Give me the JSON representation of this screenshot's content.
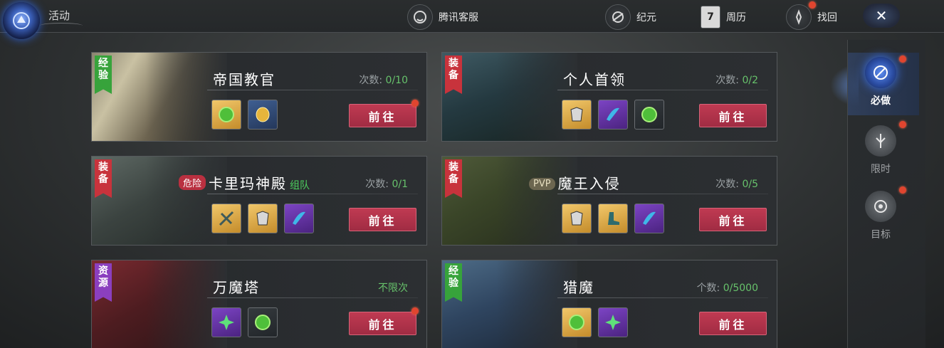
{
  "header": {
    "title": "活动",
    "buttons": [
      {
        "label": "腾讯客服",
        "icon": "customer-service-icon"
      },
      {
        "label": "纪元",
        "icon": "era-icon"
      },
      {
        "label": "周历",
        "icon": "calendar-icon",
        "calendar_day": "7"
      },
      {
        "label": "找回",
        "icon": "retrieve-icon"
      }
    ],
    "close_label": "✕"
  },
  "sidebar": {
    "items": [
      {
        "label": "必做",
        "icon": "must-do-icon",
        "active": true
      },
      {
        "label": "限时",
        "icon": "limited-time-icon",
        "active": false
      },
      {
        "label": "目标",
        "icon": "target-icon",
        "active": false
      }
    ]
  },
  "activities": [
    {
      "tag": "经验",
      "tag_color": "#37a33b",
      "name": "帝国教官",
      "count_label": "次数:",
      "count_value": "0/10",
      "go_label": "前往",
      "items": [
        "exp-orb",
        "gold-coin"
      ]
    },
    {
      "tag": "装备",
      "tag_color": "#c8333c",
      "name": "个人首领",
      "count_label": "次数:",
      "count_value": "0/2",
      "go_label": "前往",
      "items": [
        "armor-chest",
        "crystal-wing",
        "exp-orb"
      ]
    },
    {
      "tag": "装备",
      "tag_color": "#c8333c",
      "badge": "危险",
      "name": "卡里玛神殿",
      "team": "组队",
      "count_label": "次数:",
      "count_value": "0/1",
      "go_label": "前往",
      "items": [
        "crossbow",
        "armor-chest",
        "crystal-wing"
      ]
    },
    {
      "tag": "装备",
      "tag_color": "#c8333c",
      "badge": "PVP",
      "name": "魔王入侵",
      "count_label": "次数:",
      "count_value": "0/5",
      "go_label": "前往",
      "items": [
        "armor-chest",
        "boots",
        "crystal-wing"
      ]
    },
    {
      "tag": "资源",
      "tag_color": "#8b3fbf",
      "name": "万魔塔",
      "count_label": "",
      "count_value": "不限次",
      "go_label": "前往",
      "items": [
        "green-star-gem",
        "exp-orb"
      ]
    },
    {
      "tag": "经验",
      "tag_color": "#37a33b",
      "name": "猎魔",
      "count_label": "个数:",
      "count_value": "0/5000",
      "go_label": "前往",
      "items": [
        "exp-orb",
        "green-star-gem"
      ]
    }
  ],
  "colors": {
    "accent_red": "#c03a52",
    "count_green": "#67c26b",
    "notify_red": "#e0452f"
  }
}
